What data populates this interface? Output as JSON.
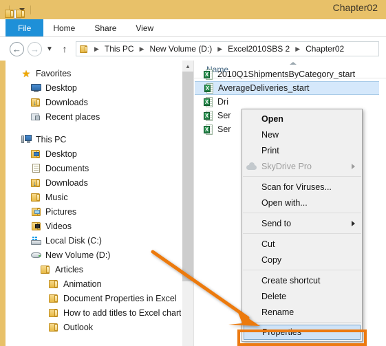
{
  "window": {
    "title": "Chapter02",
    "titlebar_color": "#e8c169",
    "accent_color": "#1e90d8",
    "annotation_color": "#ec7a11"
  },
  "quick_access": {
    "items": [
      {
        "name": "properties-icon",
        "label": "Properties"
      },
      {
        "name": "new-folder-icon",
        "label": "New folder"
      },
      {
        "name": "customize-icon",
        "label": "Customize Quick Access Toolbar"
      }
    ]
  },
  "ribbon": {
    "tabs": [
      {
        "label": "File",
        "active": true
      },
      {
        "label": "Home",
        "active": false
      },
      {
        "label": "Share",
        "active": false
      },
      {
        "label": "View",
        "active": false
      }
    ]
  },
  "address_bar": {
    "back_label": "Back",
    "forward_label": "Forward",
    "recent_label": "Recent locations",
    "up_label": "Up",
    "breadcrumbs": [
      "This PC",
      "New Volume (D:)",
      "Excel2010SBS 2",
      "Chapter02"
    ]
  },
  "navigation_pane": {
    "groups": [
      {
        "header": {
          "label": "Favorites",
          "icon": "star-icon"
        },
        "items": [
          {
            "label": "Desktop",
            "icon": "monitor-icon",
            "indent": 1
          },
          {
            "label": "Downloads",
            "icon": "downloads-folder-icon",
            "indent": 1
          },
          {
            "label": "Recent places",
            "icon": "recent-places-icon",
            "indent": 1
          }
        ]
      },
      {
        "header": {
          "label": "This PC",
          "icon": "computer-icon"
        },
        "items": [
          {
            "label": "Desktop",
            "icon": "desktop-folder-icon",
            "indent": 1
          },
          {
            "label": "Documents",
            "icon": "documents-folder-icon",
            "indent": 1
          },
          {
            "label": "Downloads",
            "icon": "downloads-folder-icon",
            "indent": 1
          },
          {
            "label": "Music",
            "icon": "music-folder-icon",
            "indent": 1
          },
          {
            "label": "Pictures",
            "icon": "pictures-folder-icon",
            "indent": 1
          },
          {
            "label": "Videos",
            "icon": "videos-folder-icon",
            "indent": 1
          },
          {
            "label": "Local Disk (C:)",
            "icon": "local-disk-icon",
            "indent": 1
          },
          {
            "label": "New Volume (D:)",
            "icon": "drive-icon",
            "indent": 1
          },
          {
            "label": "Articles",
            "icon": "folder-icon",
            "indent": 2
          },
          {
            "label": "Animation",
            "icon": "folder-icon",
            "indent": 3
          },
          {
            "label": "Document Properties in Excel",
            "icon": "folder-icon",
            "indent": 3
          },
          {
            "label": "How to add titles to Excel charts",
            "icon": "folder-icon",
            "indent": 3
          },
          {
            "label": "Outlook",
            "icon": "folder-icon",
            "indent": 3
          }
        ]
      }
    ]
  },
  "file_list": {
    "column_header": "Name",
    "sort_indicator": "ascending",
    "rows": [
      {
        "name": "2010Q1ShipmentsByCategory_start",
        "icon": "excel-file-icon",
        "selected": false
      },
      {
        "name": "AverageDeliveries_start",
        "icon": "excel-file-icon",
        "selected": true
      },
      {
        "name": "Dri",
        "icon": "excel-file-icon",
        "selected": false
      },
      {
        "name": "Ser",
        "icon": "excel-file-icon",
        "selected": false
      },
      {
        "name": "Ser",
        "icon": "excel-file-icon",
        "selected": false
      }
    ]
  },
  "context_menu": {
    "items": [
      {
        "label": "Open",
        "bold": true,
        "disabled": false,
        "submenu": false,
        "icon": null
      },
      {
        "label": "New",
        "bold": false,
        "disabled": false,
        "submenu": false,
        "icon": null
      },
      {
        "label": "Print",
        "bold": false,
        "disabled": false,
        "submenu": false,
        "icon": null
      },
      {
        "label": "SkyDrive Pro",
        "bold": false,
        "disabled": true,
        "submenu": true,
        "icon": "cloud-icon"
      },
      {
        "separator": true
      },
      {
        "label": "Scan for Viruses...",
        "bold": false,
        "disabled": false,
        "submenu": false,
        "icon": null
      },
      {
        "label": "Open with...",
        "bold": false,
        "disabled": false,
        "submenu": false,
        "icon": null
      },
      {
        "separator": true
      },
      {
        "label": "Send to",
        "bold": false,
        "disabled": false,
        "submenu": true,
        "icon": null
      },
      {
        "separator": true
      },
      {
        "label": "Cut",
        "bold": false,
        "disabled": false,
        "submenu": false,
        "icon": null
      },
      {
        "label": "Copy",
        "bold": false,
        "disabled": false,
        "submenu": false,
        "icon": null
      },
      {
        "separator": true
      },
      {
        "label": "Create shortcut",
        "bold": false,
        "disabled": false,
        "submenu": false,
        "icon": null
      },
      {
        "label": "Delete",
        "bold": false,
        "disabled": false,
        "submenu": false,
        "icon": null
      },
      {
        "label": "Rename",
        "bold": false,
        "disabled": false,
        "submenu": false,
        "icon": null
      },
      {
        "separator": true
      },
      {
        "label": "Properties",
        "bold": false,
        "disabled": false,
        "submenu": false,
        "icon": null,
        "highlighted": true
      }
    ]
  },
  "annotation": {
    "type": "arrow",
    "color": "#ec7a11",
    "points_to": "Properties",
    "highlight_box_target": "Properties"
  }
}
